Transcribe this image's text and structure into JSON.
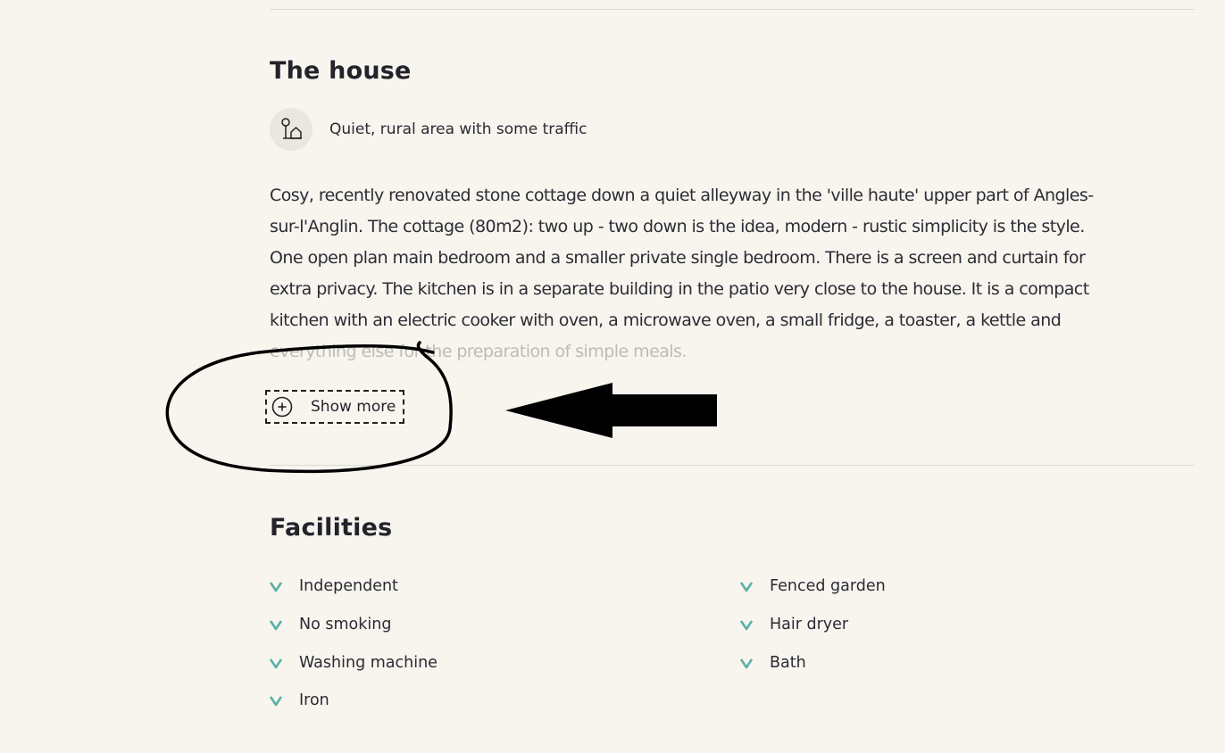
{
  "house": {
    "title": "The house",
    "area": {
      "icon": "rural-area-icon",
      "text": "Quiet, rural area with some traffic"
    },
    "description_lines": [
      "Cosy, recently renovated stone cottage down a quiet alleyway in the 'ville haute' upper part of Angles-",
      "sur-l'Anglin. The cottage (80m2): two up - two down is the idea, modern - rustic simplicity is the style.",
      "One open plan main bedroom and a smaller private single bedroom. There is a screen and curtain for",
      "extra privacy. The kitchen is in a separate building in the patio very close to the house. It is a compact",
      "kitchen with an electric cooker with oven, a microwave oven, a small fridge, a toaster, a kettle and",
      "everything else for the preparation of simple meals."
    ],
    "show_more": {
      "label": "Show more",
      "icon": "plus-circle-icon"
    }
  },
  "facilities": {
    "title": "Facilities",
    "left": [
      "Independent",
      "No smoking",
      "Washing machine",
      "Iron"
    ],
    "right": [
      "Fenced garden",
      "Hair dryer",
      "Bath"
    ],
    "check_color": "#5bb0a8",
    "icon": "check-icon"
  },
  "colors": {
    "background": "#f8f5ef",
    "text": "#23232b",
    "faded_text": "#bdbbb7",
    "accent": "#5bb0a8"
  }
}
